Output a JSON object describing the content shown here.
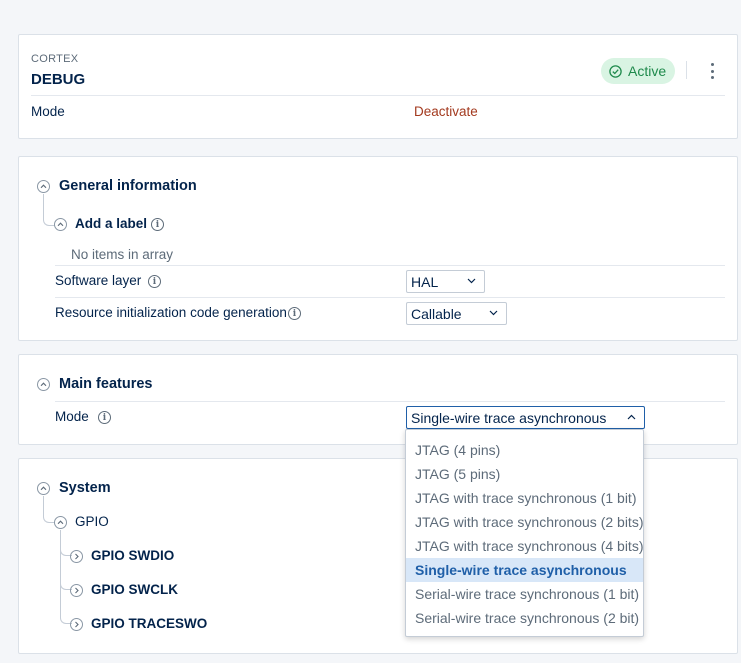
{
  "header": {
    "category": "CORTEX",
    "title": "DEBUG",
    "status": "Active",
    "mode_label": "Mode",
    "deactivate_label": "Deactivate"
  },
  "general": {
    "title": "General information",
    "add_label": "Add a label",
    "empty_text": "No items in array",
    "software_layer_label": "Software layer",
    "software_layer_value": "HAL",
    "resource_label": "Resource initialization code generation",
    "resource_value": "Callable"
  },
  "main_features": {
    "title": "Main features",
    "mode_label": "Mode",
    "mode_value": "Single-wire trace asynchronous",
    "options": [
      "JTAG (4 pins)",
      "JTAG (5 pins)",
      "JTAG with trace synchronous (1 bit)",
      "JTAG with trace synchronous (2 bits)",
      "JTAG with trace synchronous (4 bits)",
      "Single-wire trace asynchronous",
      "Serial-wire trace synchronous (1 bit)",
      "Serial-wire trace synchronous (2 bit)"
    ],
    "selected_index": 5
  },
  "system": {
    "title": "System",
    "gpio_label": "GPIO",
    "items": [
      "GPIO SWDIO",
      "GPIO SWCLK",
      "GPIO TRACESWO"
    ]
  },
  "colors": {
    "accent": "#1f5fa8",
    "active_bg": "#d9f4e3",
    "active_text": "#1f8a4c",
    "deactivate": "#a33a1f",
    "selected_bg": "#d8e7f8"
  },
  "icons": {
    "status": "check-circle-icon",
    "menu": "kebab-menu-icon",
    "collapse": "chevron-up-icon",
    "expand": "chevron-right-icon",
    "info": "info-icon",
    "add": "plus-icon",
    "dropdown": "chevron-down-icon"
  }
}
